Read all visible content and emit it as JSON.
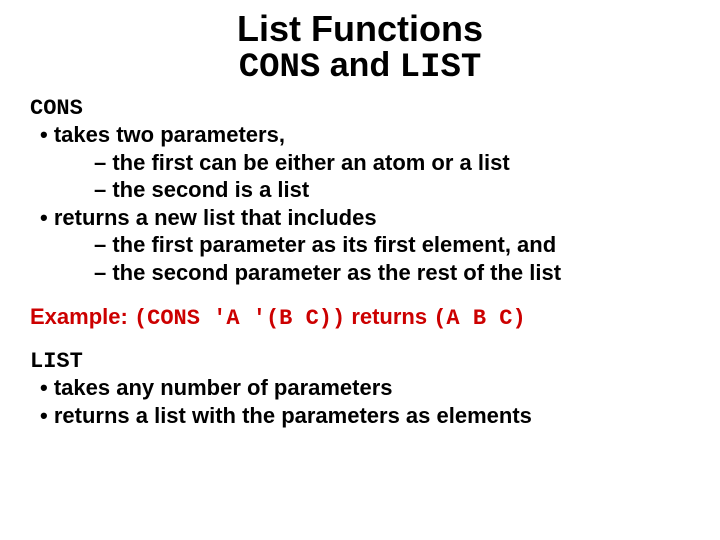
{
  "title": {
    "line1": "List Functions",
    "line2_mono1": "CONS",
    "line2_mid": " and ",
    "line2_mono2": "LIST"
  },
  "cons": {
    "heading": "CONS",
    "b1": "takes two parameters,",
    "b1a": "the first can be either an atom or a list",
    "b1b": "the second is a list",
    "b2": "returns a new list that includes",
    "b2a": "the first parameter as its first element, and",
    "b2b": "the second parameter as the rest of the list"
  },
  "example": {
    "label": "Example:",
    "code": "(CONS 'A '(B C))",
    "ret_word": " returns ",
    "ret_val": "(A B C)"
  },
  "list": {
    "heading": "LIST",
    "b1": "takes any number of parameters",
    "b2": "returns a list with the parameters as elements"
  }
}
